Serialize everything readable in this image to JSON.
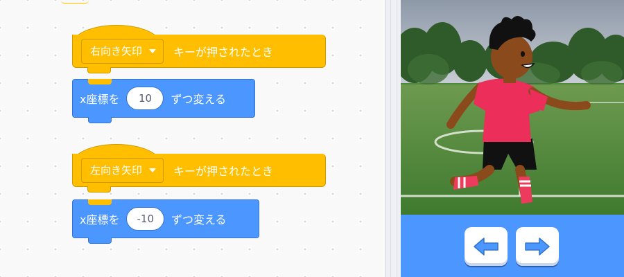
{
  "code_area": {
    "scripts": [
      {
        "hat": {
          "key_dropdown": "右向き矢印",
          "event_text": "キーが押されたとき"
        },
        "motion": {
          "label_before": "x座標を",
          "value": "10",
          "label_after": "ずつ変える"
        }
      },
      {
        "hat": {
          "key_dropdown": "左向き矢印",
          "event_text": "キーが押されたとき"
        },
        "motion": {
          "label_before": "x座標を",
          "value": "-10",
          "label_after": "ずつ変える"
        }
      }
    ]
  },
  "stage": {
    "sprite": "soccer-player",
    "backdrop": "soccer-field"
  },
  "stage_controls": {
    "left_button_icon": "left-arrow-icon",
    "right_button_icon": "right-arrow-icon"
  },
  "colors": {
    "events": "#FFBF00",
    "motion": "#4C97FF",
    "controls_bar": "#4C97FF"
  }
}
